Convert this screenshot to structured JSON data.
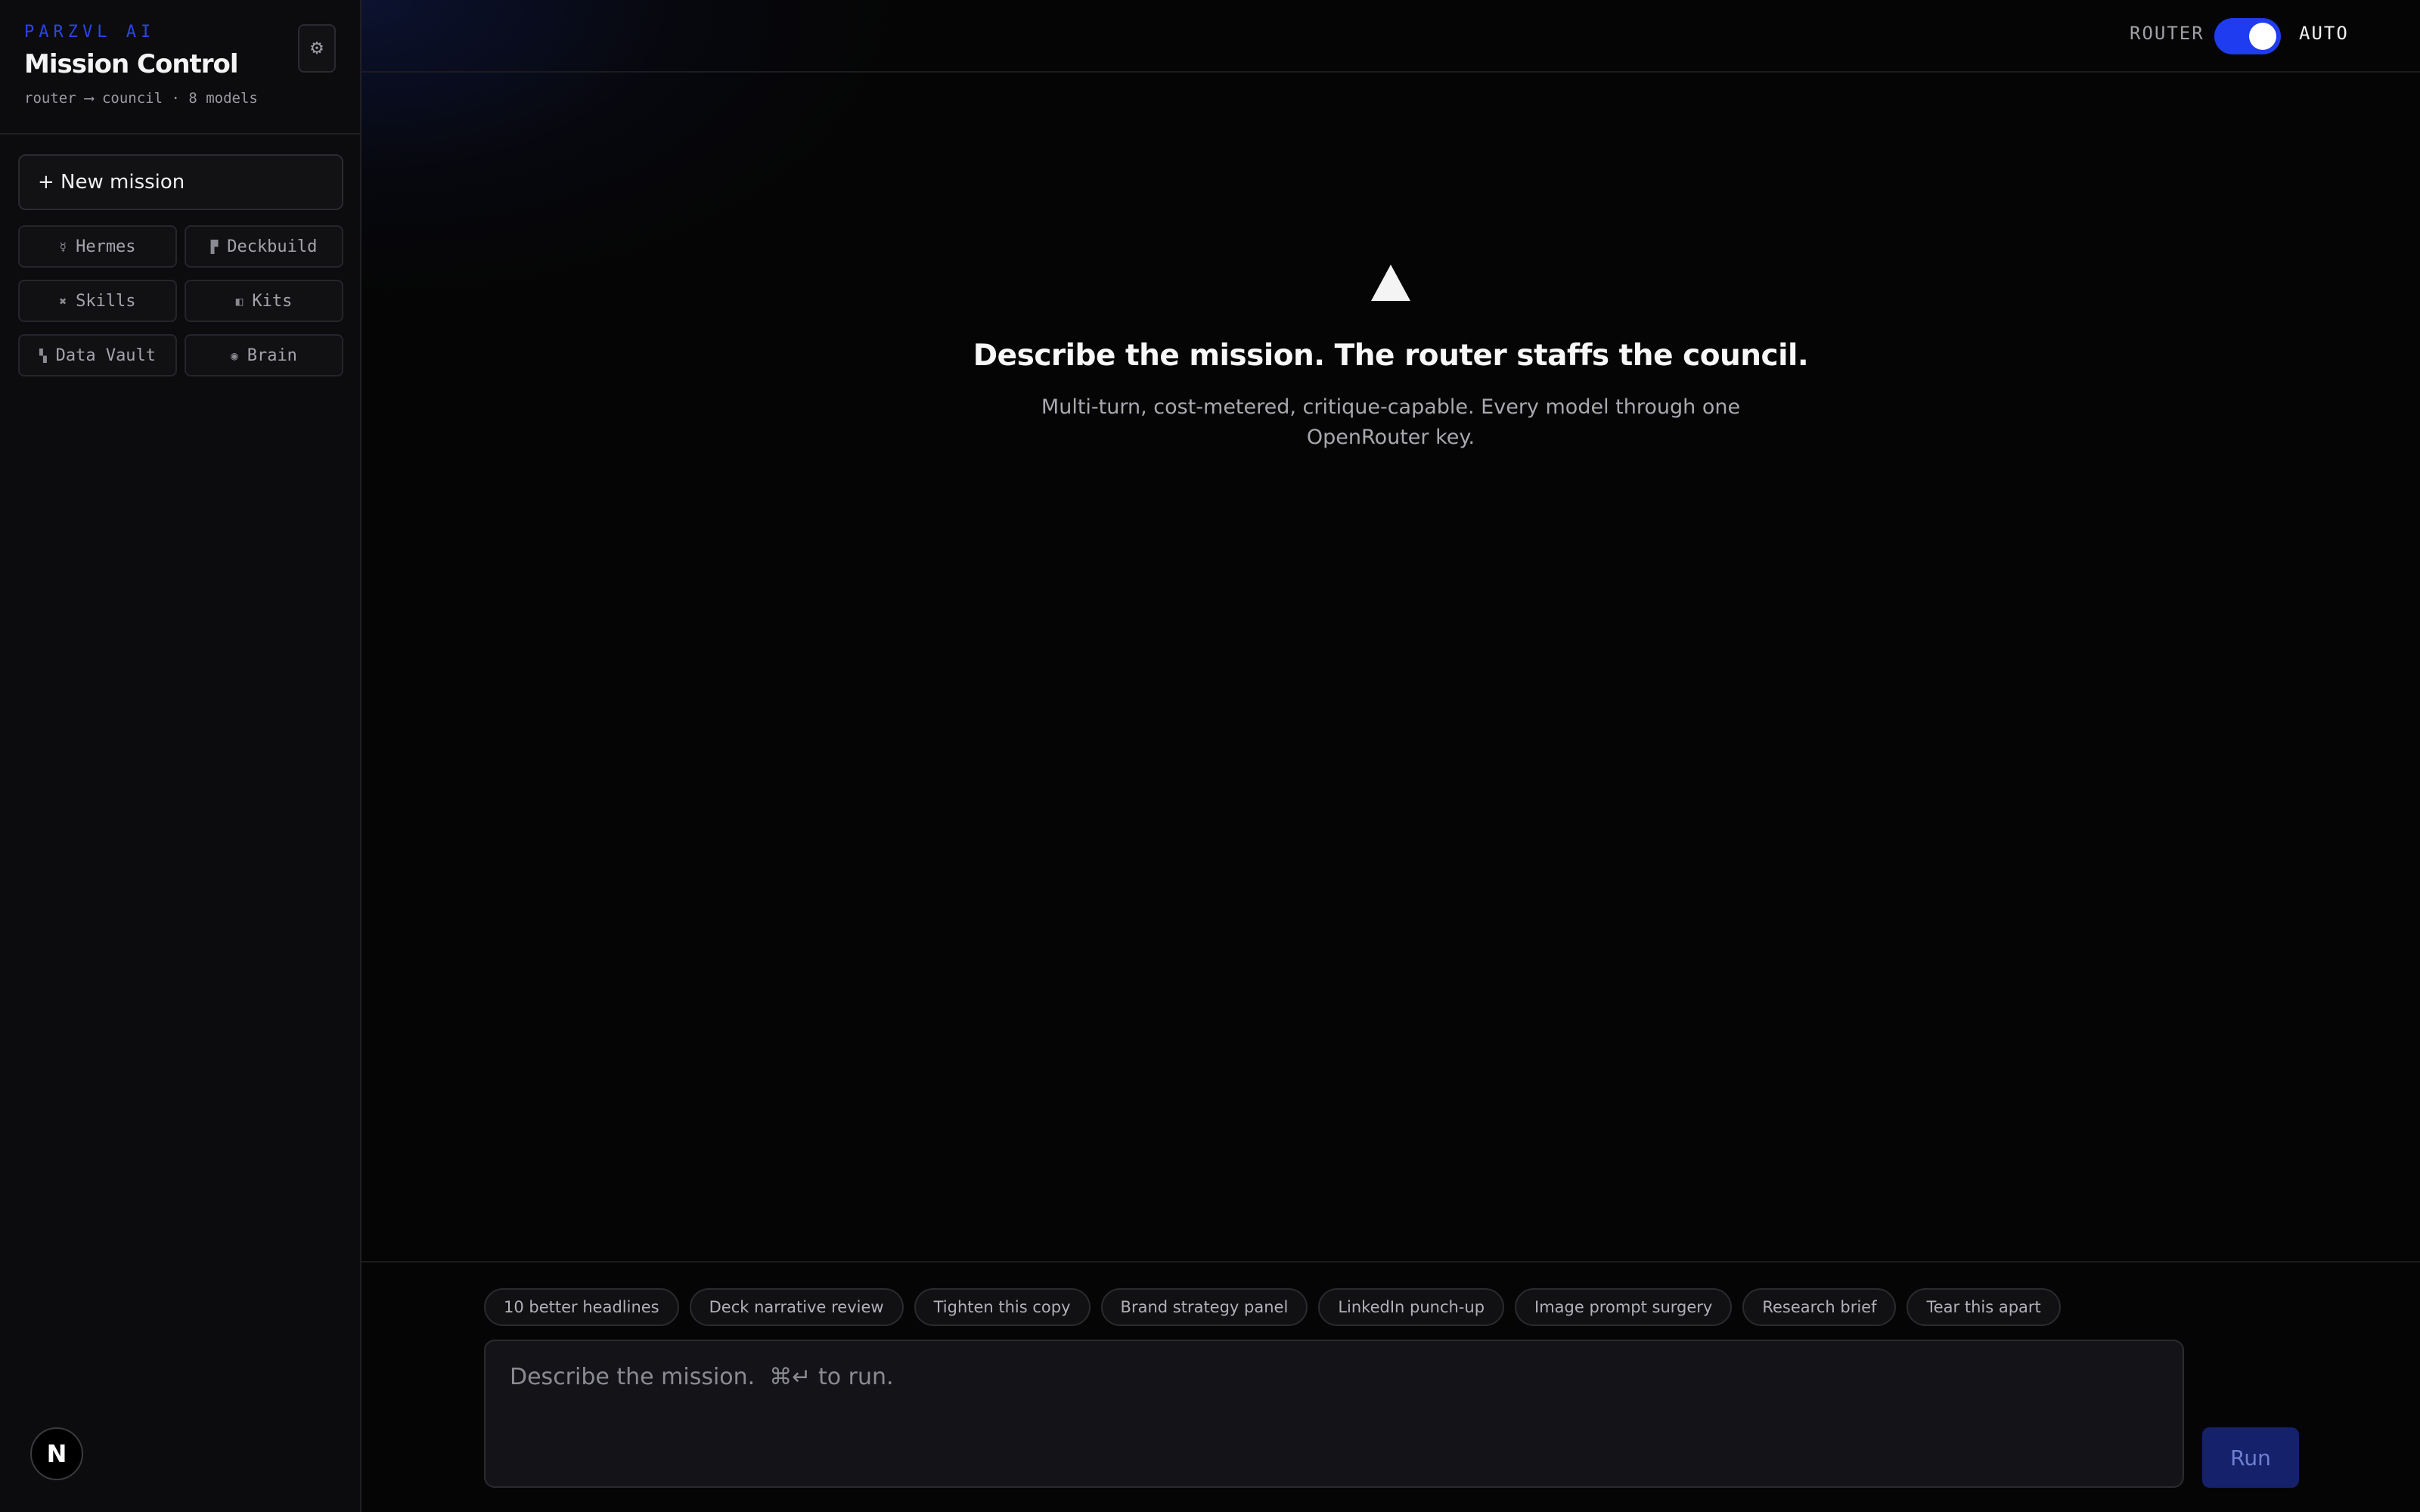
{
  "sidebar": {
    "brand": "PARZVL AI",
    "title": "Mission Control",
    "subtitle": "router ⟶ council · 8 models",
    "settings_icon": "gear-icon",
    "new_mission_label": "+ New mission",
    "nav": [
      {
        "icon": "☿",
        "label": "Hermes"
      },
      {
        "icon": "▛",
        "label": "Deckbuild"
      },
      {
        "icon": "✖",
        "label": "Skills"
      },
      {
        "icon": "◧",
        "label": "Kits"
      },
      {
        "icon": "▚",
        "label": "Data Vault"
      },
      {
        "icon": "◉",
        "label": "Brain"
      }
    ],
    "avatar_letter": "N"
  },
  "topbar": {
    "router_label": "ROUTER",
    "toggle_on": true,
    "mode_label": "AUTO"
  },
  "hero": {
    "icon": "triangle-icon",
    "heading": "Describe the mission. The router staffs the council.",
    "subheading": "Multi-turn, cost-metered, critique-capable. Every model through one OpenRouter key."
  },
  "composer": {
    "chips": [
      "10 better headlines",
      "Deck narrative review",
      "Tighten this copy",
      "Brand strategy panel",
      "LinkedIn punch-up",
      "Image prompt surgery",
      "Research brief",
      "Tear this apart"
    ],
    "placeholder": "Describe the mission.  ⌘↵ to run.",
    "value": "",
    "run_label": "Run"
  },
  "colors": {
    "accent": "#1f3cf0",
    "brand": "#2b45e6",
    "run_bg": "#15226b"
  }
}
